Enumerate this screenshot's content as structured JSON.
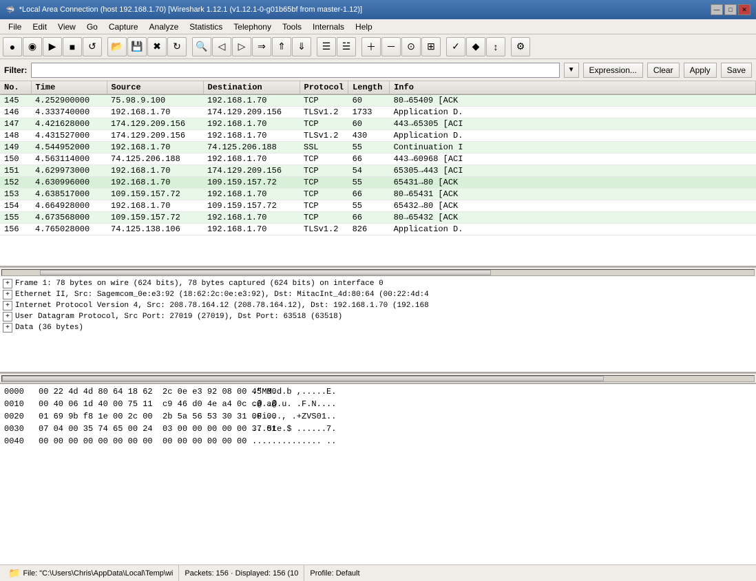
{
  "titleBar": {
    "title": "*Local Area Connection (host 192.168.1.70)  [Wireshark 1.12.1 (v1.12.1-0-g01b65bf from master-1.12)]",
    "icon": "🦈"
  },
  "windowControls": {
    "minimize": "—",
    "maximize": "□",
    "close": "✕"
  },
  "menu": {
    "items": [
      "File",
      "Edit",
      "View",
      "Go",
      "Capture",
      "Analyze",
      "Statistics",
      "Telephony",
      "Tools",
      "Internals",
      "Help"
    ]
  },
  "toolbar": {
    "buttons": [
      {
        "name": "start-capture",
        "icon": "●"
      },
      {
        "name": "stop-capture",
        "icon": "◉"
      },
      {
        "name": "capture-options",
        "icon": "▶"
      },
      {
        "name": "stop-running",
        "icon": "■"
      },
      {
        "name": "reload",
        "icon": "↺"
      },
      {
        "name": "open-file",
        "icon": "📂"
      },
      {
        "name": "save-file",
        "icon": "💾"
      },
      {
        "name": "close-file",
        "icon": "✖"
      },
      {
        "name": "reload-file",
        "icon": "↻"
      },
      {
        "name": "find-packet",
        "icon": "🔍"
      },
      {
        "name": "back",
        "icon": "←"
      },
      {
        "name": "forward",
        "icon": "→"
      },
      {
        "name": "go-to-packet",
        "icon": "⇒"
      },
      {
        "name": "first-packet",
        "icon": "⇑"
      },
      {
        "name": "last-packet",
        "icon": "⇓"
      },
      {
        "name": "packet-list-toggle",
        "icon": "☰"
      },
      {
        "name": "packet-detail-toggle",
        "icon": "☱"
      },
      {
        "name": "zoom-in",
        "icon": "🔍"
      },
      {
        "name": "zoom-out",
        "icon": "🔎"
      },
      {
        "name": "normal-size",
        "icon": "⊙"
      },
      {
        "name": "resize-columns",
        "icon": "⊞"
      },
      {
        "name": "mark-packet",
        "icon": "✓"
      },
      {
        "name": "colorize",
        "icon": "🎨"
      },
      {
        "name": "auto-scroll",
        "icon": "↕"
      },
      {
        "name": "preferences",
        "icon": "⚙"
      }
    ]
  },
  "filterBar": {
    "label": "Filter:",
    "placeholder": "",
    "value": "",
    "buttons": [
      "Expression...",
      "Clear",
      "Apply",
      "Save"
    ]
  },
  "packetList": {
    "columns": [
      "No.",
      "Time",
      "Source",
      "Destination",
      "Protocol",
      "Length",
      "Info"
    ],
    "rows": [
      {
        "no": "145",
        "time": "4.252900000",
        "src": "75.98.9.100",
        "dst": "192.168.1.70",
        "proto": "TCP",
        "len": "60",
        "info": "80→65409 [ACK",
        "color": "normal"
      },
      {
        "no": "146",
        "time": "4.333740000",
        "src": "192.168.1.70",
        "dst": "174.129.209.156",
        "proto": "TLSv1.2",
        "len": "1733",
        "info": "Application D.",
        "color": "normal"
      },
      {
        "no": "147",
        "time": "4.421628000",
        "src": "174.129.209.156",
        "dst": "192.168.1.70",
        "proto": "TCP",
        "len": "60",
        "info": "443→65305 [ACI",
        "color": "normal"
      },
      {
        "no": "148",
        "time": "4.431527000",
        "src": "174.129.209.156",
        "dst": "192.168.1.70",
        "proto": "TLSv1.2",
        "len": "430",
        "info": "Application D.",
        "color": "normal"
      },
      {
        "no": "149",
        "time": "4.544952000",
        "src": "192.168.1.70",
        "dst": "74.125.206.188",
        "proto": "SSL",
        "len": "55",
        "info": "Continuation I",
        "color": "normal"
      },
      {
        "no": "150",
        "time": "4.563114000",
        "src": "74.125.206.188",
        "dst": "192.168.1.70",
        "proto": "TCP",
        "len": "66",
        "info": "443→60968 [ACI",
        "color": "normal"
      },
      {
        "no": "151",
        "time": "4.629973000",
        "src": "192.168.1.70",
        "dst": "174.129.209.156",
        "proto": "TCP",
        "len": "54",
        "info": "65305→443 [ACI",
        "color": "normal"
      },
      {
        "no": "152",
        "time": "4.630996000",
        "src": "192.168.1.70",
        "dst": "109.159.157.72",
        "proto": "TCP",
        "len": "55",
        "info": "65431→80 [ACK",
        "color": "green"
      },
      {
        "no": "153",
        "time": "4.638517000",
        "src": "109.159.157.72",
        "dst": "192.168.1.70",
        "proto": "TCP",
        "len": "66",
        "info": "80→65431 [ACK",
        "color": "normal"
      },
      {
        "no": "154",
        "time": "4.664928000",
        "src": "192.168.1.70",
        "dst": "109.159.157.72",
        "proto": "TCP",
        "len": "55",
        "info": "65432→80 [ACK",
        "color": "normal"
      },
      {
        "no": "155",
        "time": "4.673568000",
        "src": "109.159.157.72",
        "dst": "192.168.1.70",
        "proto": "TCP",
        "len": "66",
        "info": "80→65432 [ACK",
        "color": "normal"
      },
      {
        "no": "156",
        "time": "4.765028000",
        "src": "74.125.138.106",
        "dst": "192.168.1.70",
        "proto": "TLSv1.2",
        "len": "826",
        "info": "Application D.",
        "color": "normal"
      }
    ]
  },
  "packetDetail": {
    "rows": [
      {
        "text": "Frame 1: 78 bytes on wire (624 bits), 78 bytes captured (624 bits) on interface 0"
      },
      {
        "text": "Ethernet II, Src: Sagemcom_0e:e3:92 (18:62:2c:0e:e3:92), Dst: MitacInt_4d:80:64 (00:22:4d:4"
      },
      {
        "text": "Internet Protocol Version 4, Src: 208.78.164.12 (208.78.164.12), Dst: 192.168.1.70 (192.168"
      },
      {
        "text": "User Datagram Protocol, Src Port: 27019 (27019), Dst Port: 63518 (63518)"
      },
      {
        "text": "Data (36 bytes)"
      }
    ]
  },
  "hexDump": {
    "rows": [
      {
        "offset": "0000",
        "bytes": "00 22 4d 4d 80 64 18 62  2c 0e e3 92 08 00 45 00",
        "ascii": ".\"MM.d.b ,.....E."
      },
      {
        "offset": "0010",
        "bytes": "00 40 06 1d 40 00 75 11  c9 46 d0 4e a4 0c c0 a8",
        "ascii": ".@..@.u. .F.N...."
      },
      {
        "offset": "0020",
        "bytes": "01 69 9b f8 1e 00 2c 00  2b 5a 56 53 30 31 00 00",
        "ascii": ".Fi..., .+ZVS01.."
      },
      {
        "offset": "0030",
        "bytes": "07 04 00 35 74 65 00 24  03 00 00 00 00 00 37 01",
        "ascii": "...5te.$ ......7."
      },
      {
        "offset": "0040",
        "bytes": "00 00 00 00 00 00 00 00  00 00 00 00 00 00",
        "ascii": ".............. .."
      }
    ]
  },
  "statusBar": {
    "file": "File: \"C:\\Users\\Chris\\AppData\\Local\\Temp\\wi",
    "packets": "Packets: 156 · Displayed: 156 (10",
    "profile": "Profile: Default"
  }
}
